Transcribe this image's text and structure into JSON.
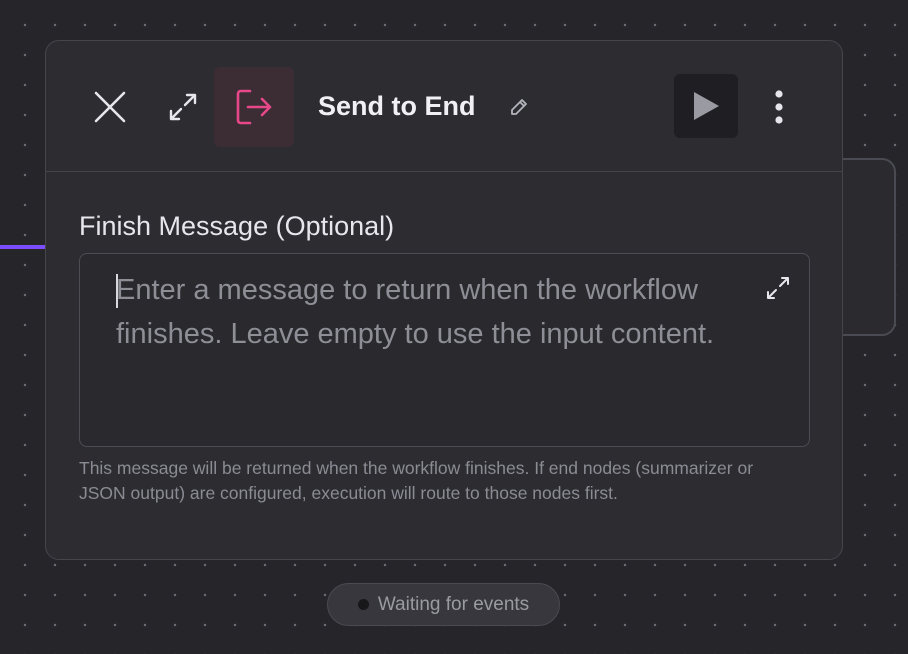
{
  "node": {
    "title": "Send to End",
    "icon": "exit-icon",
    "accent_color": "#e8488a"
  },
  "field": {
    "label": "Finish Message (Optional)",
    "value": "",
    "placeholder": "Enter a message to return when the workflow finishes. Leave empty to use the input content.",
    "helper": "This message will be returned when the workflow finishes. If end nodes (summarizer or JSON output) are configured, execution will route to those nodes first."
  },
  "status": {
    "text": "Waiting for events"
  },
  "colors": {
    "edge": "#7c4dff",
    "background": "#25252a",
    "panel": "#2c2c31"
  }
}
